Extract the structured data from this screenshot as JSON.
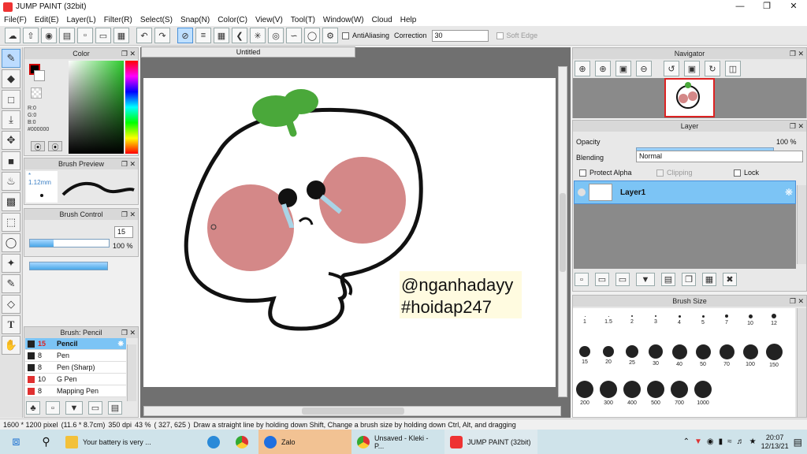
{
  "window": {
    "title": "JUMP PAINT (32bit)"
  },
  "menu": [
    "File(F)",
    "Edit(E)",
    "Layer(L)",
    "Filter(R)",
    "Select(S)",
    "Snap(N)",
    "Color(C)",
    "View(V)",
    "Tool(T)",
    "Window(W)",
    "Cloud",
    "Help"
  ],
  "toolbar": {
    "antialiasing": "AntiAliasing",
    "correction_label": "Correction",
    "correction_value": "30",
    "soft_edge": "Soft Edge"
  },
  "color_panel": {
    "title": "Color",
    "r": "R:0",
    "g": "G:0",
    "b": "B:0",
    "hex": "#000000"
  },
  "brush_preview": {
    "title": "Brush Preview",
    "size": "1.12mm"
  },
  "brush_control": {
    "title": "Brush Control",
    "size_value": "15",
    "opacity_value": "100 %",
    "size_fraction": 0.3,
    "opacity_fraction": 1.0
  },
  "brush_list": {
    "title": "Brush: Pencil",
    "items": [
      {
        "size": "15",
        "name": "Pencil",
        "color": "#222222"
      },
      {
        "size": "8",
        "name": "Pen",
        "color": "#222222"
      },
      {
        "size": "8",
        "name": "Pen (Sharp)",
        "color": "#222222"
      },
      {
        "size": "10",
        "name": "G Pen",
        "color": "#e03030"
      },
      {
        "size": "8",
        "name": "Mapping Pen",
        "color": "#e03030"
      }
    ]
  },
  "document": {
    "tab": "Untitled",
    "text1": "@nganhadayy",
    "text2": "#hoidap247"
  },
  "navigator": {
    "title": "Navigator"
  },
  "layer_panel": {
    "title": "Layer",
    "opacity_label": "Opacity",
    "opacity_value": "100 %",
    "blending_label": "Blending",
    "blending_value": "Normal",
    "protect_alpha": "Protect Alpha",
    "clipping": "Clipping",
    "lock": "Lock",
    "layer_name": "Layer1"
  },
  "brush_size": {
    "title": "Brush Size",
    "sizes": [
      "1",
      "1.5",
      "2",
      "3",
      "4",
      "5",
      "7",
      "10",
      "12",
      "15",
      "20",
      "25",
      "30",
      "40",
      "50",
      "70",
      "100",
      "150",
      "200",
      "300",
      "400",
      "500",
      "700",
      "1000"
    ]
  },
  "status": {
    "dims": "1600 * 1200 pixel",
    "mm": "(11.6 * 8.7cm)",
    "dpi": "350 dpi",
    "zoom": "43 %",
    "coords": "( 327, 625 )",
    "hint": "Draw a straight line by holding down Shift, Change a brush size by holding down Ctrl, Alt, and dragging"
  },
  "taskbar": {
    "items": [
      {
        "label": "Your battery is very ...",
        "color": "#f3c13a"
      },
      {
        "label": "Zalo",
        "color": "#1e6fe0"
      },
      {
        "label": "Unsaved - Kleki - P...",
        "color": "#e0a020"
      },
      {
        "label": "JUMP PAINT (32bit)",
        "color": "#e33"
      }
    ],
    "time": "20:07",
    "date": "12/13/21"
  }
}
